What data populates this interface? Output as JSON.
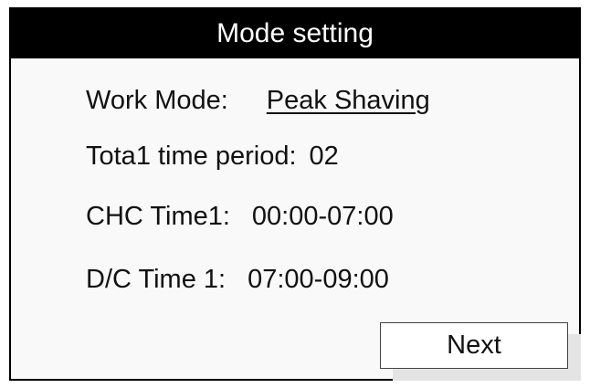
{
  "header": {
    "title": "Mode setting"
  },
  "settings": {
    "work_mode_label": "Work Mode:",
    "work_mode_value": "Peak Shaving",
    "total_period_label": "Tota1 time period:",
    "total_period_value": "02",
    "chc_time_label": "CHC Time1:",
    "chc_time_value": "00:00-07:00",
    "dc_time_label": "D/C Time 1:",
    "dc_time_value": "07:00-09:00"
  },
  "actions": {
    "next_label": "Next"
  }
}
